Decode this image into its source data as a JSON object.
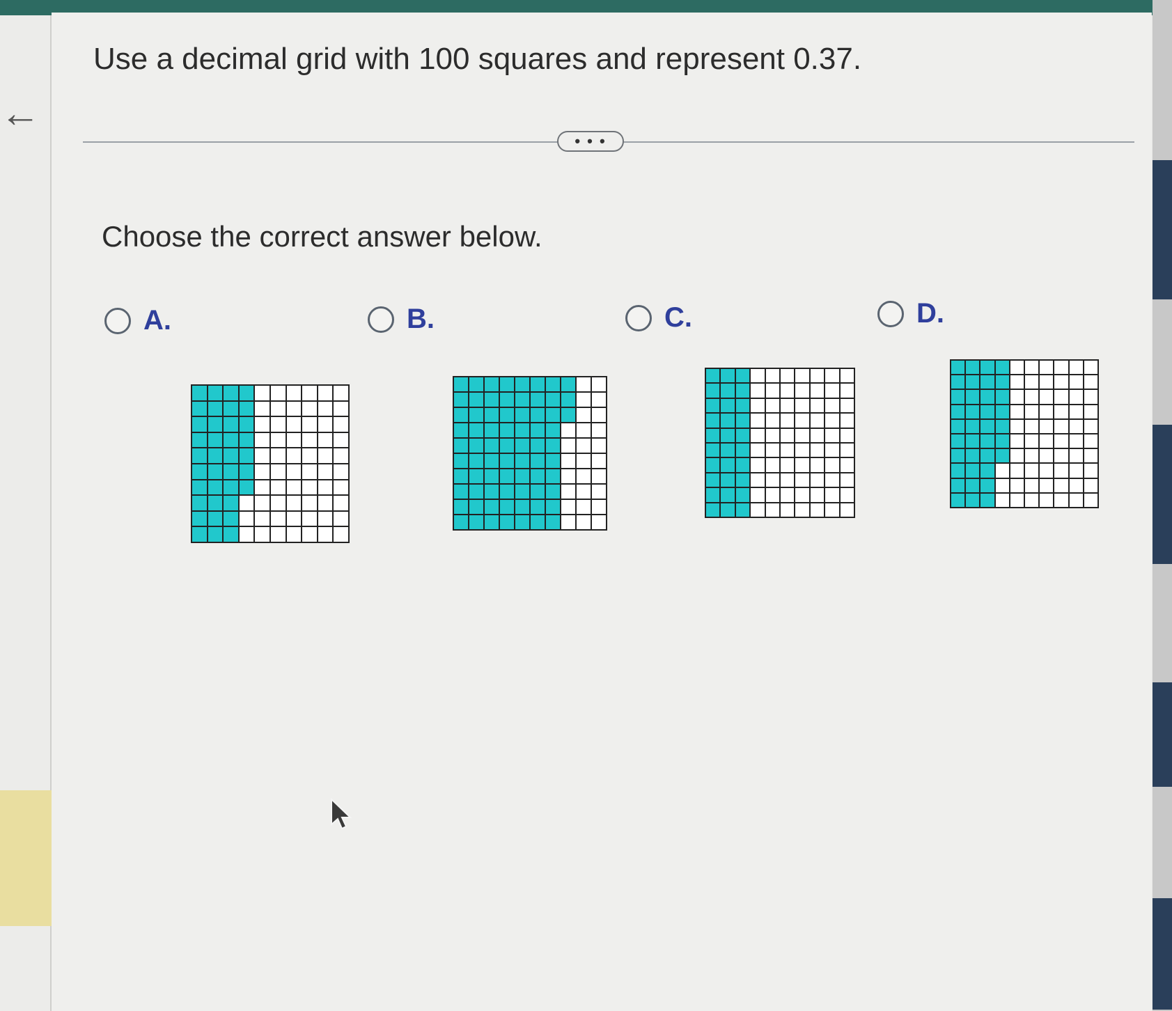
{
  "question": {
    "text": "Use a decimal grid with 100 squares and represent 0.37."
  },
  "more_button": {
    "label": "• • •"
  },
  "prompt": {
    "text": "Choose the correct answer below."
  },
  "options": [
    {
      "label": "A.",
      "shaded": 37
    },
    {
      "label": "B.",
      "shaded": 73
    },
    {
      "label": "C.",
      "shaded": 30
    },
    {
      "label": "D.",
      "shaded": 37
    }
  ],
  "colors": {
    "shade": "#21c8cc",
    "label": "#2f3f9c",
    "top_bar": "#2d6b62"
  },
  "icons": {
    "back": "arrow-left-icon",
    "cursor": "mouse-pointer-icon"
  }
}
